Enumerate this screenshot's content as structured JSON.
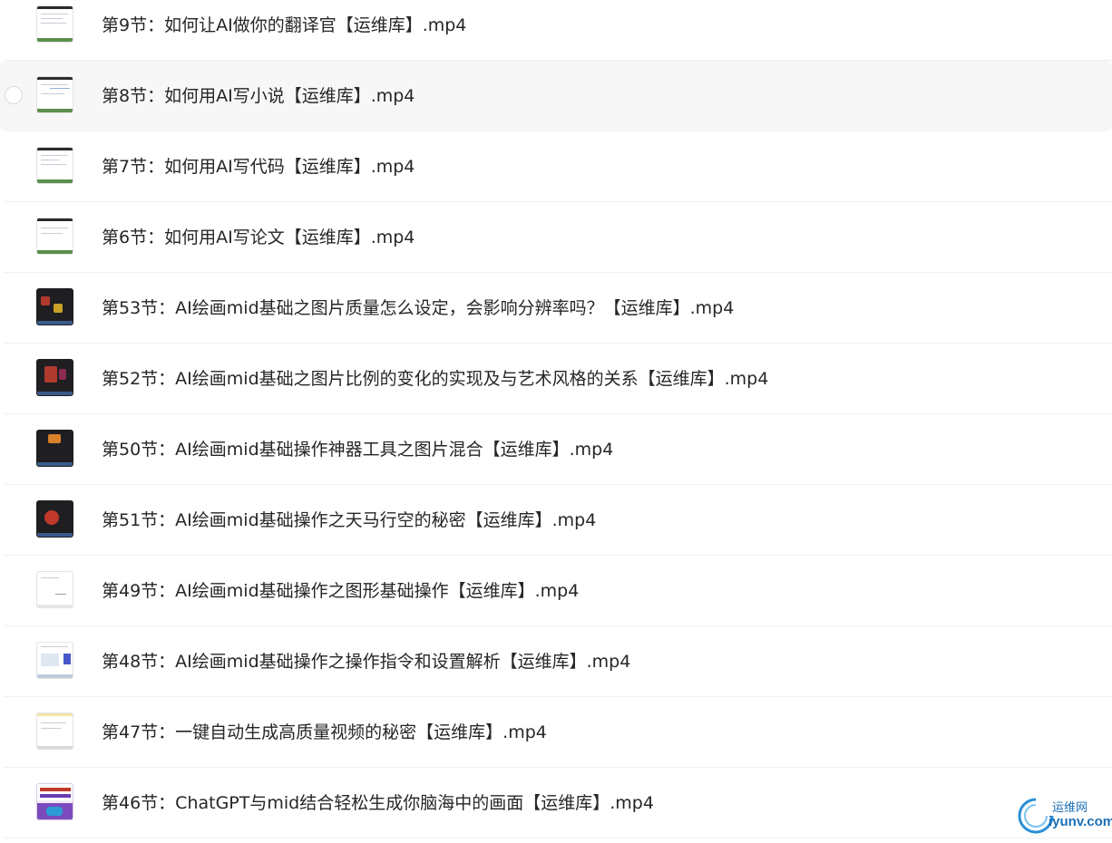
{
  "files": [
    {
      "name": "第9节：如何让AI做你的翻译官【运维库】.mp4",
      "thumbnail": "document-screenshot-thumbnail"
    },
    {
      "name": "第8节：如何用AI写小说【运维库】.mp4",
      "thumbnail": "document-screenshot-thumbnail",
      "hovered": true
    },
    {
      "name": "第7节：如何用AI写代码【运维库】.mp4",
      "thumbnail": "document-screenshot-thumbnail"
    },
    {
      "name": "第6节：如何用AI写论文【运维库】.mp4",
      "thumbnail": "document-screenshot-thumbnail"
    },
    {
      "name": "第53节：AI绘画mid基础之图片质量怎么设定，会影响分辨率吗？【运维库】.mp4",
      "thumbnail": "dark-app-screenshot-thumbnail"
    },
    {
      "name": "第52节：AI绘画mid基础之图片比例的变化的实现及与艺术风格的关系【运维库】.mp4",
      "thumbnail": "dark-app-screenshot-thumbnail"
    },
    {
      "name": "第50节：AI绘画mid基础操作神器工具之图片混合【运维库】.mp4",
      "thumbnail": "dark-app-screenshot-thumbnail"
    },
    {
      "name": "第51节：AI绘画mid基础操作之天马行空的秘密【运维库】.mp4",
      "thumbnail": "dark-app-screenshot-thumbnail"
    },
    {
      "name": "第49节：AI绘画mid基础操作之图形基础操作【运维库】.mp4",
      "thumbnail": "light-page-screenshot-thumbnail"
    },
    {
      "name": "第48节：AI绘画mid基础操作之操作指令和设置解析【运维库】.mp4",
      "thumbnail": "web-page-screenshot-thumbnail"
    },
    {
      "name": "第47节：一键自动生成高质量视频的秘密【运维库】.mp4",
      "thumbnail": "light-page-screenshot-thumbnail"
    },
    {
      "name": "第46节：ChatGPT与mid结合轻松生成你脑海中的画面【运维库】.mp4",
      "thumbnail": "chatgpt-midjourney-poster-thumbnail"
    }
  ],
  "watermark": {
    "cn_text": "运维网",
    "en_text": "iyunv.com"
  },
  "colors": {
    "text": "#262626",
    "hover_bg": "#f7f7f7",
    "divider": "#f0f0f0",
    "watermark": "#1b6fb6"
  }
}
